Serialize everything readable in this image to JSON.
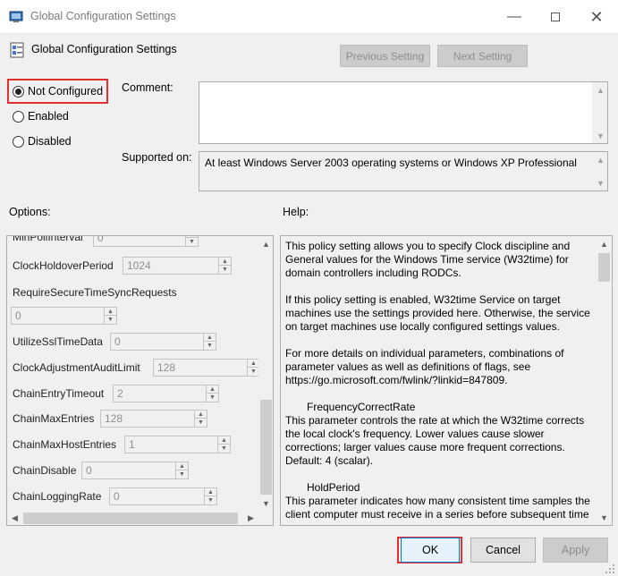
{
  "window": {
    "title": "Global Configuration Settings"
  },
  "header": {
    "title": "Global Configuration Settings",
    "previous_label": "Previous Setting",
    "next_label": "Next Setting"
  },
  "state": {
    "options": [
      {
        "label": "Not Configured",
        "selected": true
      },
      {
        "label": "Enabled",
        "selected": false
      },
      {
        "label": "Disabled",
        "selected": false
      }
    ]
  },
  "comment": {
    "label": "Comment:",
    "value": ""
  },
  "supported": {
    "label": "Supported on:",
    "value": "At least Windows Server 2003 operating systems or Windows XP Professional"
  },
  "options_panel": {
    "label": "Options:",
    "partial_row": {
      "label": "MinPollInterval",
      "value": "0"
    },
    "items": [
      {
        "label": "ClockHoldoverPeriod",
        "value": "1024"
      },
      {
        "label": "RequireSecureTimeSyncRequests",
        "value": "0"
      },
      {
        "label": "UtilizeSslTimeData",
        "value": "0"
      },
      {
        "label": "ClockAdjustmentAuditLimit",
        "value": "128"
      },
      {
        "label": "ChainEntryTimeout",
        "value": "2"
      },
      {
        "label": "ChainMaxEntries",
        "value": "128"
      },
      {
        "label": "ChainMaxHostEntries",
        "value": "1"
      },
      {
        "label": "ChainDisable",
        "value": "0"
      },
      {
        "label": "ChainLoggingRate",
        "value": "0"
      }
    ]
  },
  "help_panel": {
    "label": "Help:",
    "paragraphs": [
      "This policy setting allows you to specify Clock discipline and General values for the Windows Time service (W32time) for domain controllers including RODCs.",
      "If this policy setting is enabled, W32time Service on target machines use the settings provided here. Otherwise, the service on target machines use locally configured settings values.",
      "For more details on individual parameters, combinations of parameter values as well as definitions of flags, see https://go.microsoft.com/fwlink/?linkid=847809.",
      "FrequencyCorrectRate",
      "This parameter controls the rate at which the W32time corrects the local clock's frequency. Lower values cause slower corrections; larger values cause more frequent corrections. Default: 4 (scalar).",
      "HoldPeriod",
      "This parameter indicates how many consistent time samples the client computer must receive in a series before subsequent time"
    ]
  },
  "footer": {
    "ok_label": "OK",
    "cancel_label": "Cancel",
    "apply_label": "Apply"
  },
  "colors": {
    "highlight": "#e03030",
    "window_bg": "#f0f0f0"
  }
}
